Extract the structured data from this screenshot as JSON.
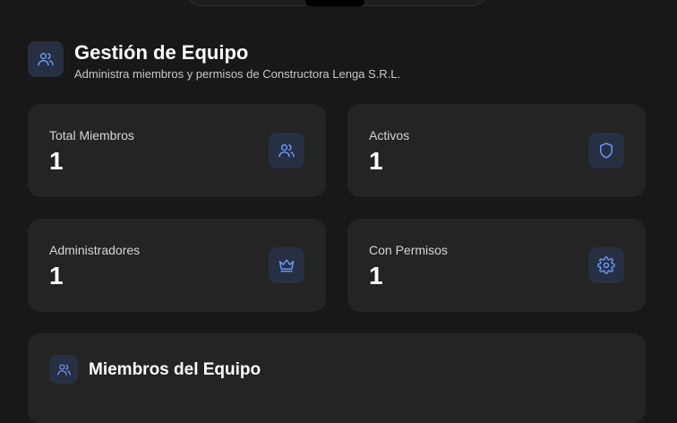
{
  "header": {
    "title": "Gestión de Equipo",
    "subtitle": "Administra miembros y permisos de Constructora Lenga S.R.L.",
    "icon": "users-icon"
  },
  "stats": [
    {
      "label": "Total Miembros",
      "value": "1",
      "icon": "users-icon"
    },
    {
      "label": "Activos",
      "value": "1",
      "icon": "shield-icon"
    },
    {
      "label": "Administradores",
      "value": "1",
      "icon": "crown-icon"
    },
    {
      "label": "Con Permisos",
      "value": "1",
      "icon": "gear-icon"
    }
  ],
  "members_section": {
    "title": "Miembros del Equipo",
    "icon": "users-icon"
  },
  "colors": {
    "background": "#181818",
    "card": "#242424",
    "icon_bg": "#263042",
    "accent": "#6d9bff"
  }
}
